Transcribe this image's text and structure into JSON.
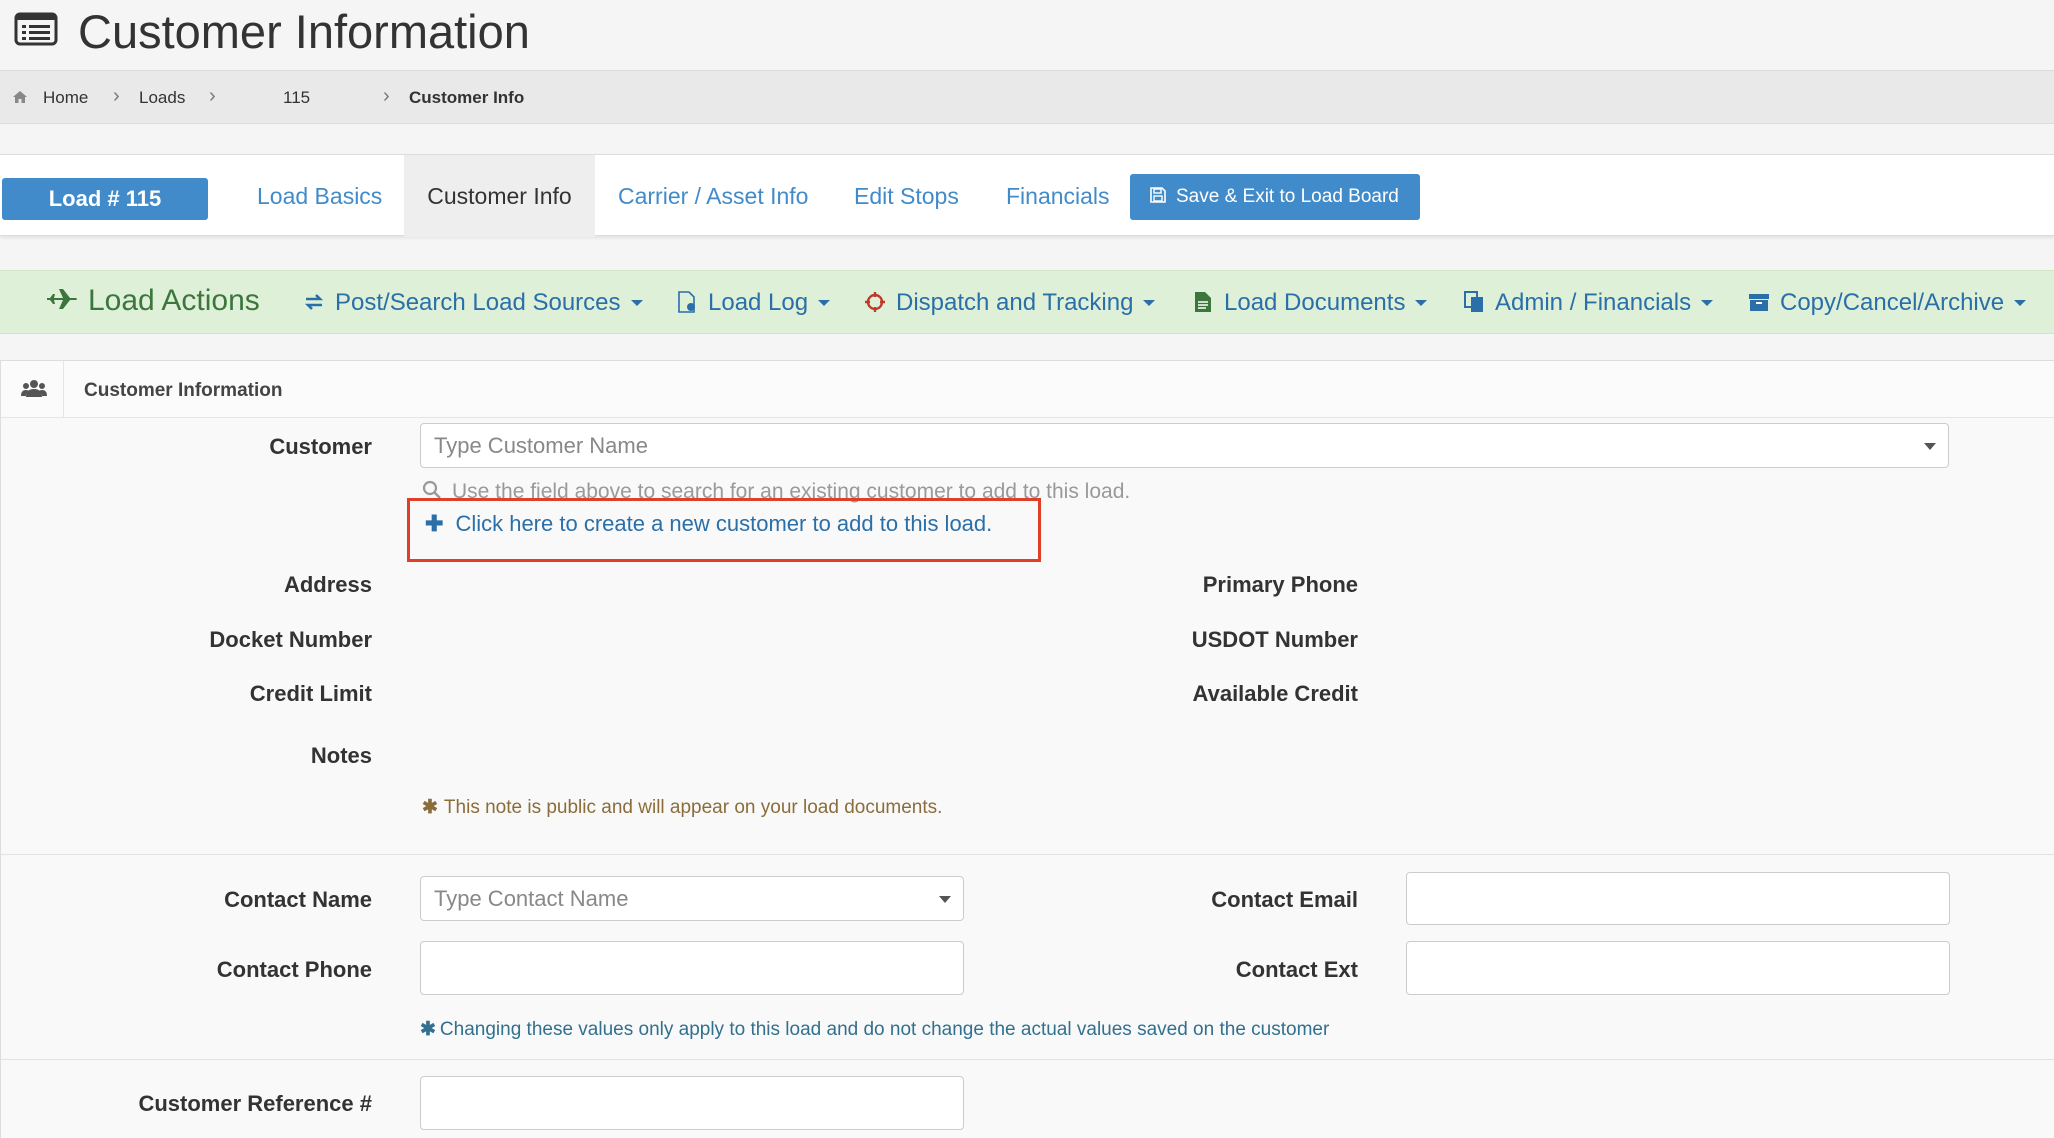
{
  "header": {
    "title": "Customer Information",
    "icon": "list-alt-icon"
  },
  "breadcrumb": {
    "home": "Home",
    "loads": "Loads",
    "load_id": "115",
    "current": "Customer Info"
  },
  "tabs": {
    "load_badge": "Load # 115",
    "items": [
      "Load Basics",
      "Customer Info",
      "Carrier / Asset Info",
      "Edit Stops",
      "Financials"
    ],
    "active": "Customer Info",
    "save_label": "Save & Exit to Load Board"
  },
  "actions": {
    "title": "Load Actions",
    "items": [
      "Post/Search Load Sources",
      "Load Log",
      "Dispatch and Tracking",
      "Load Documents",
      "Admin / Financials",
      "Copy/Cancel/Archive"
    ]
  },
  "panel": {
    "title": "Customer Information",
    "customer_label": "Customer",
    "customer_placeholder": "Type Customer Name",
    "customer_help": "Use the field above to search for an existing customer to add to this load.",
    "create_link": "Click here to create a new customer to add to this load.",
    "address_label": "Address",
    "primary_phone_label": "Primary Phone",
    "docket_label": "Docket Number",
    "usdot_label": "USDOT Number",
    "credit_limit_label": "Credit Limit",
    "available_credit_label": "Available Credit",
    "notes_label": "Notes",
    "notes_public": "This note is public and will appear on your load documents.",
    "contact_name_label": "Contact Name",
    "contact_name_placeholder": "Type Contact Name",
    "contact_email_label": "Contact Email",
    "contact_phone_label": "Contact Phone",
    "contact_ext_label": "Contact Ext",
    "contact_note": "Changing these values only apply to this load and do not change the actual values saved on the customer",
    "customer_ref_label": "Customer Reference #"
  },
  "colors": {
    "primary": "#428bca",
    "link": "#2a6fa8",
    "actions_bg": "#dff0d8",
    "actions_text": "#3c763d",
    "highlight_box": "#e0402a"
  }
}
